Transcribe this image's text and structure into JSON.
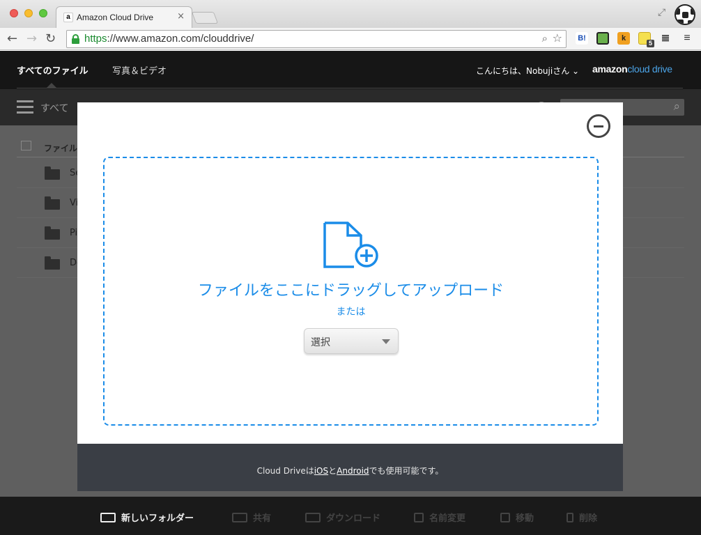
{
  "browser": {
    "tab_title": "Amazon Cloud Drive",
    "tab_favicon": "a",
    "tab_close": "×",
    "url_scheme": "https",
    "url_rest": "://www.amazon.com/clouddrive/",
    "extensions": [
      "B!",
      "",
      "k",
      "",
      ""
    ],
    "extension_badge": "5"
  },
  "topnav": {
    "all_files": "すべてのファイル",
    "photos_videos": "写真＆ビデオ",
    "greeting": "こんにちは、Nobujiさん",
    "logo_main": "amazon",
    "logo_sub": "cloud drive"
  },
  "subbar": {
    "filter_label": "すべて"
  },
  "list": {
    "header": "ファイル",
    "rows": [
      "Se",
      "Vi",
      "Pi",
      "Do"
    ]
  },
  "bottom_actions": {
    "new_folder": "新しいフォルダー",
    "share": "共有",
    "download": "ダウンロード",
    "rename": "名前変更",
    "move": "移動",
    "delete": "削除"
  },
  "modal": {
    "drop_text": "ファイルをここにドラッグしてアップロード",
    "or_text": "または",
    "select_label": "選択",
    "footer_prefix": "Cloud Driveは",
    "footer_ios": "iOS",
    "footer_mid": "と",
    "footer_android": "Android",
    "footer_suffix": "でも使用可能です。"
  },
  "colors": {
    "accent": "#1a8ce8",
    "footer_bg": "#3a3e45"
  }
}
